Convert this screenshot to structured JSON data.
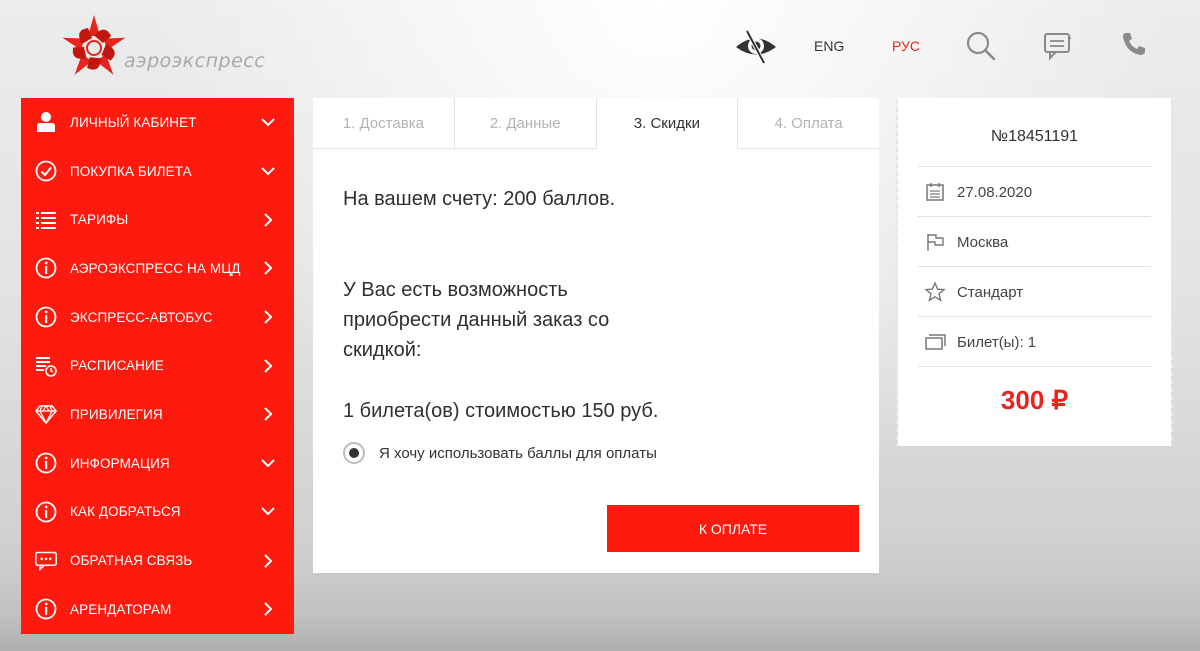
{
  "header": {
    "logo_text": "аэроэкспресс",
    "lang_eng": "ENG",
    "lang_rus": "РУС",
    "accent_color": "#e8241c"
  },
  "sidebar": {
    "background": "#ff1a0f",
    "items": [
      {
        "label": "ЛИЧНЫЙ КАБИНЕТ",
        "icon": "user-icon",
        "arrow": "chevron-down-icon"
      },
      {
        "label": "ПОКУПКА БИЛЕТА",
        "icon": "check-circle-icon",
        "arrow": "chevron-down-icon"
      },
      {
        "label": "ТАРИФЫ",
        "icon": "list-icon",
        "arrow": "chevron-right-icon"
      },
      {
        "label": "АЭРОЭКСПРЕСС НА МЦД",
        "icon": "info-icon",
        "arrow": "chevron-right-icon"
      },
      {
        "label": "ЭКСПРЕСС-АВТОБУС",
        "icon": "info-icon",
        "arrow": "chevron-right-icon"
      },
      {
        "label": "РАСПИСАНИЕ",
        "icon": "schedule-icon",
        "arrow": "chevron-right-icon"
      },
      {
        "label": "ПРИВИЛЕГИЯ",
        "icon": "diamond-icon",
        "arrow": "chevron-right-icon"
      },
      {
        "label": "ИНФОРМАЦИЯ",
        "icon": "info-icon",
        "arrow": "chevron-down-icon"
      },
      {
        "label": "КАК ДОБРАТЬСЯ",
        "icon": "info-icon",
        "arrow": "chevron-down-icon"
      },
      {
        "label": "ОБРАТНАЯ СВЯЗЬ",
        "icon": "chat-icon",
        "arrow": "chevron-right-icon"
      },
      {
        "label": "АРЕНДАТОРАМ",
        "icon": "info-icon",
        "arrow": "chevron-right-icon"
      }
    ]
  },
  "steps": {
    "tabs": [
      {
        "label": "1. Доставка",
        "active": false
      },
      {
        "label": "2. Данные",
        "active": false
      },
      {
        "label": "3. Скидки",
        "active": true
      },
      {
        "label": "4. Оплата",
        "active": false
      }
    ]
  },
  "discount": {
    "balance_text": "На вашем счету: 200 баллов.",
    "offer_line1": "У Вас есть возможность",
    "offer_line2": "приобрести данный заказ со",
    "offer_line3": "скидкой:",
    "price_text": "1 билета(ов) стоимостью 150 руб.",
    "use_points_label": "Я хочу использовать баллы для оплаты",
    "use_points_checked": true,
    "pay_button": "К ОПЛАТЕ"
  },
  "ticket": {
    "number": "№18451191",
    "date": "27.08.2020",
    "city": "Москва",
    "tariff": "Стандарт",
    "count": "Билет(ы): 1",
    "price": "300 ₽"
  }
}
